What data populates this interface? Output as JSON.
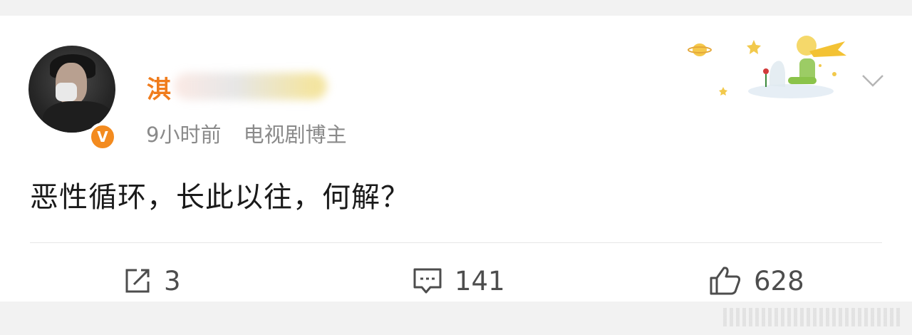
{
  "post": {
    "author": {
      "name_visible": "淇",
      "verified_badge": "V",
      "verified_color": "#f38b1f"
    },
    "time": "9小时前",
    "author_tag": "电视剧博主",
    "content": "恶性循环，长此以往，何解？"
  },
  "actions": {
    "repost_count": "3",
    "comment_count": "141",
    "like_count": "628"
  },
  "colors": {
    "name": "#f07c1c",
    "meta": "#8a8a8a",
    "icon": "#4d4d4d"
  },
  "icons": [
    "repost-icon",
    "comment-icon",
    "like-icon",
    "chevron-down-icon"
  ]
}
